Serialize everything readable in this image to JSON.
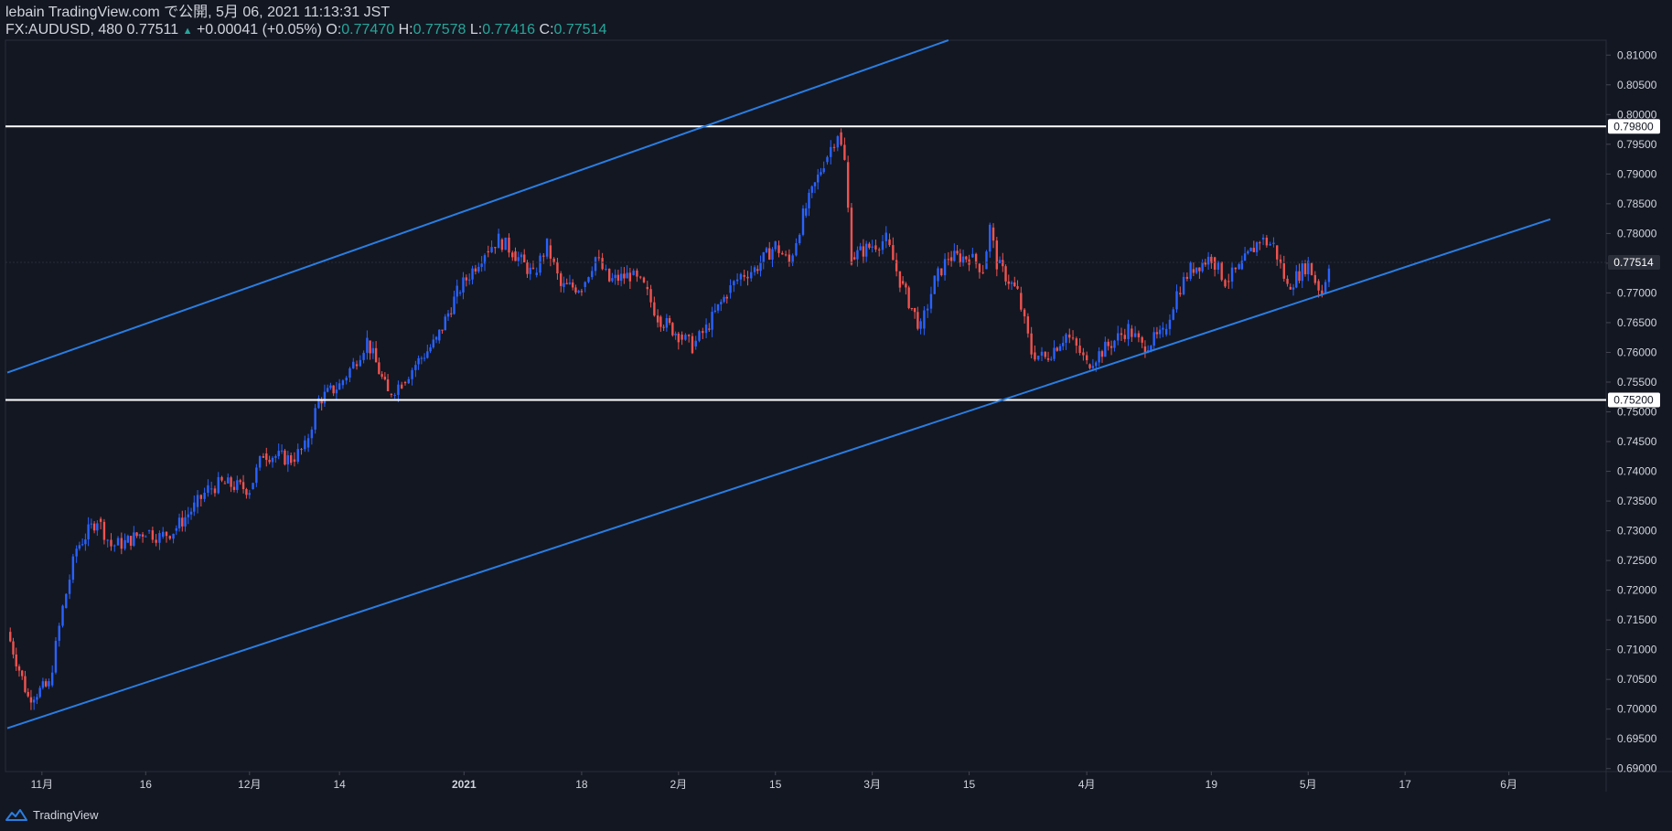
{
  "header": {
    "published": "lebain TradingView.com で公開, 5月 06, 2021 11:13:31 JST",
    "symbol_interval_price": "FX:AUDUSD, 480 0.77511",
    "change_arrow": "▲",
    "change": "+0.00041 (+0.05%)",
    "o_label": "O:",
    "o_value": "0.77470",
    "h_label": "H:",
    "h_value": "0.77578",
    "l_label": "L:",
    "l_value": "0.77416",
    "c_label": "C:",
    "c_value": "0.77514"
  },
  "footer": {
    "brand": "TradingView"
  },
  "colors": {
    "background": "#131722",
    "up": "#2962ff",
    "down": "#ef5350",
    "trendline": "#2a7de1",
    "horizontal": "#ffffff",
    "axis_text": "#d1d4dc",
    "teal": "#26a69a"
  },
  "chart_data": {
    "type": "candlestick",
    "symbol": "FX:AUDUSD",
    "interval": "480",
    "ylim": [
      0.6895,
      0.8125
    ],
    "y_ticks": [
      "0.81000",
      "0.80500",
      "0.80000",
      "0.79500",
      "0.79000",
      "0.78500",
      "0.78000",
      "0.77500",
      "0.77000",
      "0.76500",
      "0.76000",
      "0.75500",
      "0.75000",
      "0.74500",
      "0.74000",
      "0.73500",
      "0.73000",
      "0.72500",
      "0.72000",
      "0.71500",
      "0.71000",
      "0.70500",
      "0.70000",
      "0.69500",
      "0.69000"
    ],
    "x_labels": [
      {
        "label": "11月",
        "date": "2020-11-01"
      },
      {
        "label": "16",
        "date": "2020-11-16"
      },
      {
        "label": "12月",
        "date": "2020-12-01"
      },
      {
        "label": "14",
        "date": "2020-12-14"
      },
      {
        "label": "2021",
        "date": "2021-01-01"
      },
      {
        "label": "18",
        "date": "2021-01-18"
      },
      {
        "label": "2月",
        "date": "2021-02-01"
      },
      {
        "label": "15",
        "date": "2021-02-15"
      },
      {
        "label": "3月",
        "date": "2021-03-01"
      },
      {
        "label": "15",
        "date": "2021-03-15"
      },
      {
        "label": "4月",
        "date": "2021-04-01"
      },
      {
        "label": "19",
        "date": "2021-04-19"
      },
      {
        "label": "5月",
        "date": "2021-05-03"
      },
      {
        "label": "17",
        "date": "2021-05-17"
      },
      {
        "label": "6月",
        "date": "2021-06-01"
      }
    ],
    "horizontal_lines": [
      {
        "price": 0.798,
        "label": "0.79800"
      },
      {
        "price": 0.752,
        "label": "0.75200"
      }
    ],
    "current_price": {
      "price": 0.77514,
      "label": "0.77514"
    },
    "trendlines": [
      {
        "name": "upper-channel",
        "from": {
          "date": "2020-10-27",
          "price": 0.7566
        },
        "to": {
          "date": "2021-03-12",
          "price": 0.8125
        }
      },
      {
        "name": "lower-channel",
        "from": {
          "date": "2020-10-27",
          "price": 0.6968
        },
        "to": {
          "date": "2021-06-07",
          "price": 0.7824
        }
      }
    ],
    "price_path": [
      [
        "2020-10-27",
        0.713
      ],
      [
        "2020-10-30",
        0.702
      ],
      [
        "2020-11-02",
        0.704
      ],
      [
        "2020-11-04",
        0.717
      ],
      [
        "2020-11-06",
        0.727
      ],
      [
        "2020-11-09",
        0.732
      ],
      [
        "2020-11-11",
        0.7275
      ],
      [
        "2020-11-13",
        0.728
      ],
      [
        "2020-11-16",
        0.73
      ],
      [
        "2020-11-18",
        0.729
      ],
      [
        "2020-11-20",
        0.73
      ],
      [
        "2020-11-23",
        0.734
      ],
      [
        "2020-11-25",
        0.737
      ],
      [
        "2020-11-27",
        0.738
      ],
      [
        "2020-12-01",
        0.737
      ],
      [
        "2020-12-03",
        0.743
      ],
      [
        "2020-12-07",
        0.742
      ],
      [
        "2020-12-09",
        0.744
      ],
      [
        "2020-12-11",
        0.752
      ],
      [
        "2020-12-14",
        0.7545
      ],
      [
        "2020-12-16",
        0.758
      ],
      [
        "2020-12-18",
        0.762
      ],
      [
        "2020-12-21",
        0.753
      ],
      [
        "2020-12-23",
        0.755
      ],
      [
        "2020-12-25",
        0.758
      ],
      [
        "2020-12-28",
        0.762
      ],
      [
        "2020-12-31",
        0.77
      ],
      [
        "2021-01-04",
        0.777
      ],
      [
        "2021-01-06",
        0.779
      ],
      [
        "2021-01-08",
        0.777
      ],
      [
        "2021-01-11",
        0.773
      ],
      [
        "2021-01-13",
        0.778
      ],
      [
        "2021-01-15",
        0.771
      ],
      [
        "2021-01-18",
        0.771
      ],
      [
        "2021-01-20",
        0.776
      ],
      [
        "2021-01-22",
        0.772
      ],
      [
        "2021-01-25",
        0.773
      ],
      [
        "2021-01-27",
        0.771
      ],
      [
        "2021-01-29",
        0.766
      ],
      [
        "2021-02-01",
        0.763
      ],
      [
        "2021-02-03",
        0.761
      ],
      [
        "2021-02-05",
        0.764
      ],
      [
        "2021-02-08",
        0.77
      ],
      [
        "2021-02-10",
        0.773
      ],
      [
        "2021-02-12",
        0.774
      ],
      [
        "2021-02-15",
        0.778
      ],
      [
        "2021-02-17",
        0.775
      ],
      [
        "2021-02-19",
        0.783
      ],
      [
        "2021-02-22",
        0.792
      ],
      [
        "2021-02-24",
        0.797
      ],
      [
        "2021-02-25",
        0.792
      ],
      [
        "2021-02-26",
        0.776
      ],
      [
        "2021-03-01",
        0.778
      ],
      [
        "2021-03-03",
        0.779
      ],
      [
        "2021-03-05",
        0.772
      ],
      [
        "2021-03-08",
        0.764
      ],
      [
        "2021-03-10",
        0.772
      ],
      [
        "2021-03-12",
        0.776
      ],
      [
        "2021-03-15",
        0.776
      ],
      [
        "2021-03-17",
        0.774
      ],
      [
        "2021-03-18",
        0.781
      ],
      [
        "2021-03-19",
        0.775
      ],
      [
        "2021-03-22",
        0.77
      ],
      [
        "2021-03-24",
        0.76
      ],
      [
        "2021-03-26",
        0.759
      ],
      [
        "2021-03-29",
        0.763
      ],
      [
        "2021-03-31",
        0.76
      ],
      [
        "2021-04-01",
        0.758
      ],
      [
        "2021-04-05",
        0.762
      ],
      [
        "2021-04-07",
        0.764
      ],
      [
        "2021-04-09",
        0.761
      ],
      [
        "2021-04-12",
        0.763
      ],
      [
        "2021-04-14",
        0.77
      ],
      [
        "2021-04-16",
        0.774
      ],
      [
        "2021-04-19",
        0.776
      ],
      [
        "2021-04-21",
        0.772
      ],
      [
        "2021-04-23",
        0.774
      ],
      [
        "2021-04-26",
        0.779
      ],
      [
        "2021-04-28",
        0.778
      ],
      [
        "2021-04-30",
        0.771
      ],
      [
        "2021-05-03",
        0.775
      ],
      [
        "2021-05-04",
        0.772
      ],
      [
        "2021-05-05",
        0.77
      ],
      [
        "2021-05-06",
        0.7751
      ]
    ]
  }
}
